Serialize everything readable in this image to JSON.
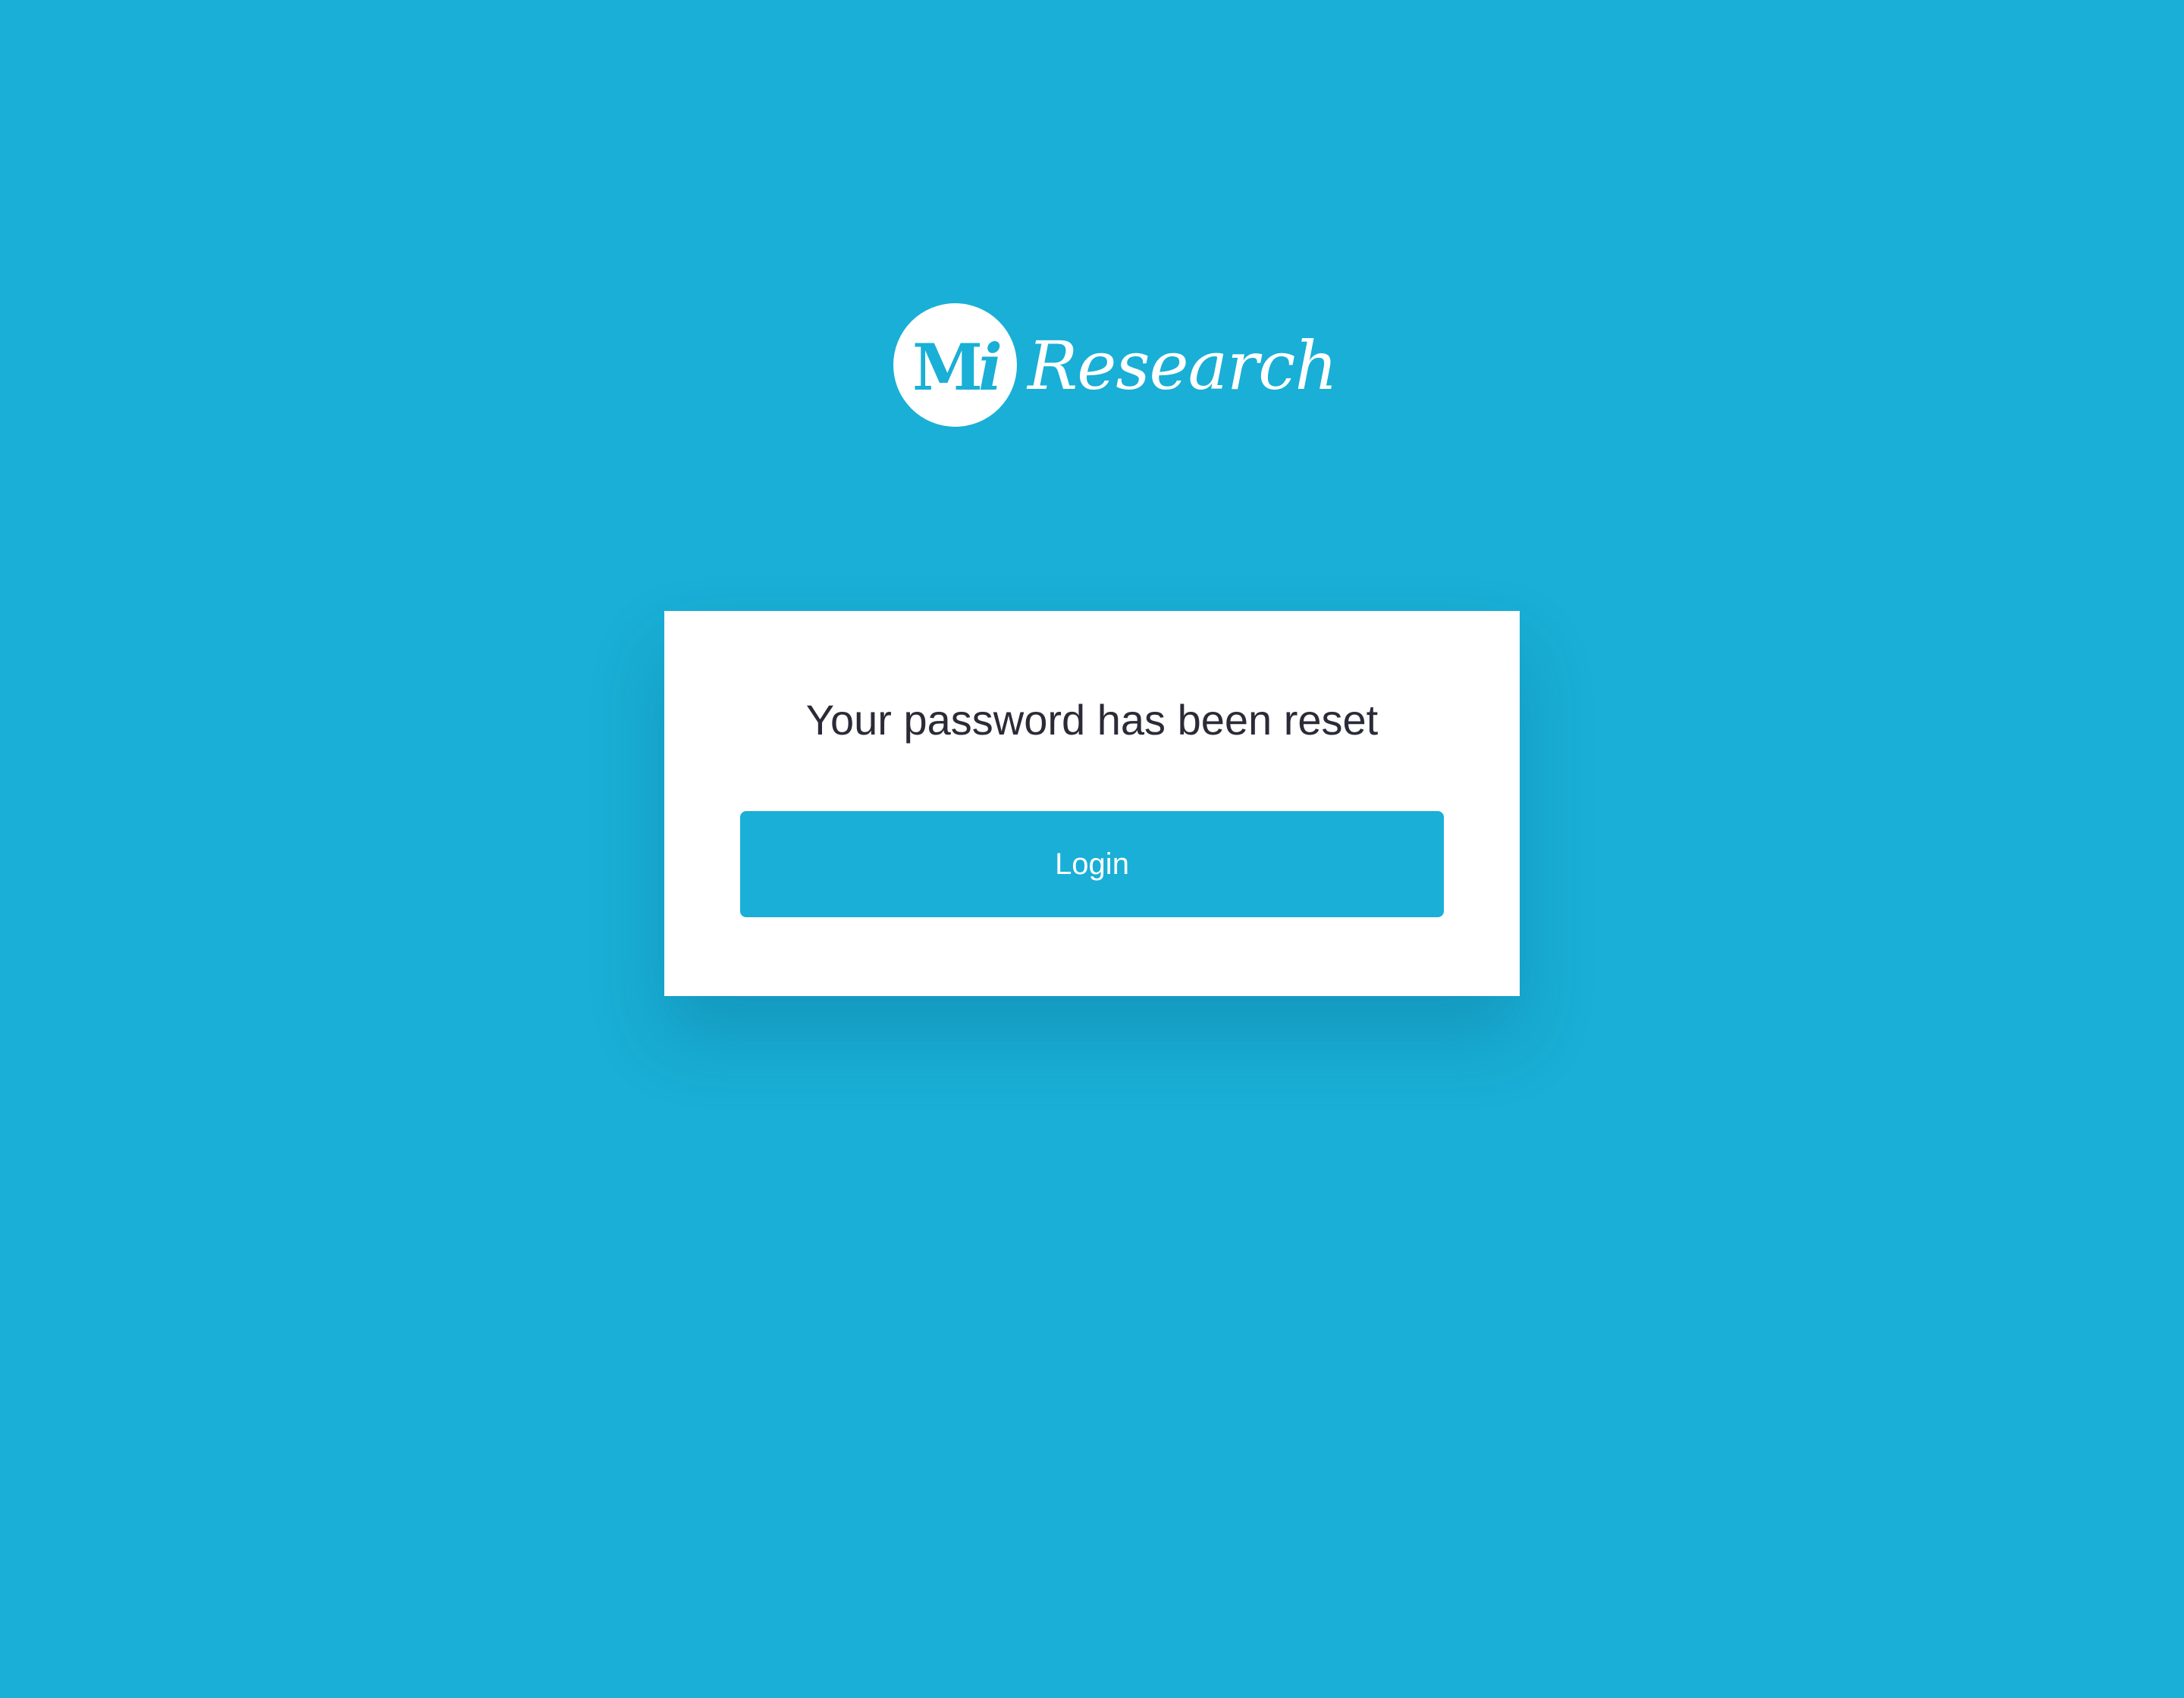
{
  "logo": {
    "badge_text": "Mi",
    "word": "Research"
  },
  "card": {
    "title": "Your password has been reset",
    "login_label": "Login"
  },
  "colors": {
    "background": "#19afd6",
    "card": "#ffffff",
    "button": "#19afd6",
    "title_text": "#2b2b38"
  }
}
